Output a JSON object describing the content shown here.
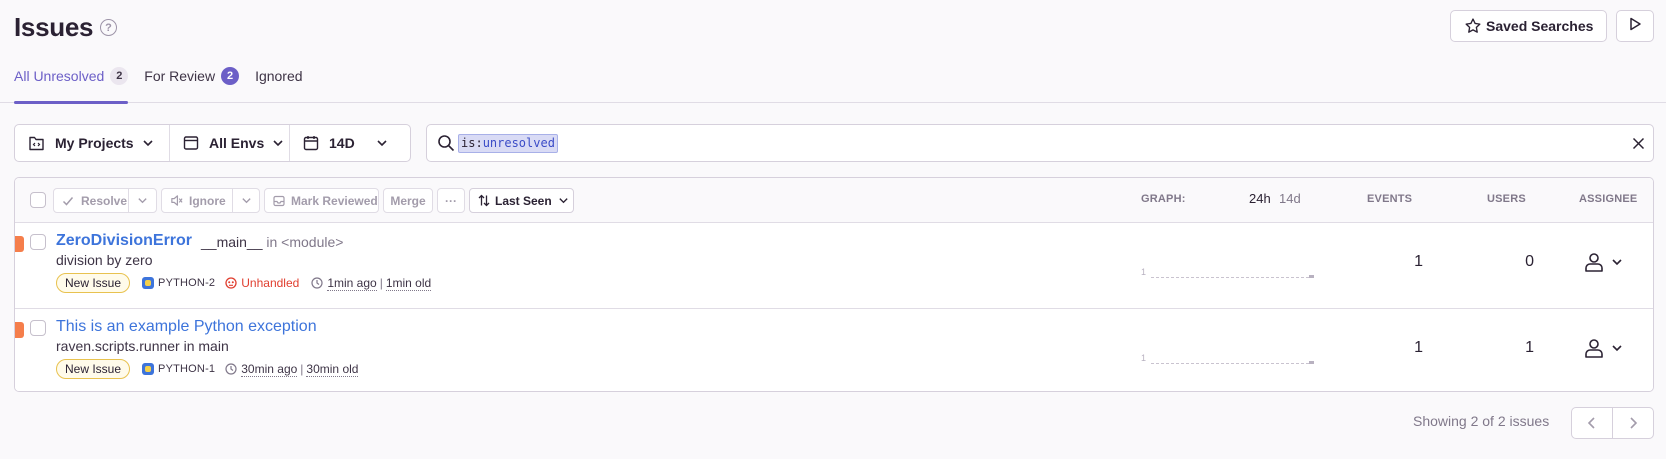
{
  "header": {
    "title": "Issues",
    "help_glyph": "?",
    "saved_searches_label": "Saved Searches"
  },
  "tabs": [
    {
      "label": "All Unresolved",
      "count": "2"
    },
    {
      "label": "For Review",
      "count": "2"
    },
    {
      "label": "Ignored"
    }
  ],
  "filters": {
    "projects": "My Projects",
    "environments": "All Envs",
    "date": "14D"
  },
  "search": {
    "key": "is:",
    "value": "unresolved"
  },
  "toolbar": {
    "resolve": "Resolve",
    "ignore": "Ignore",
    "mark_reviewed": "Mark Reviewed",
    "merge": "Merge",
    "more": "···",
    "sort": "Last Seen"
  },
  "columns": {
    "graph": "GRAPH:",
    "period_24h": "24h",
    "period_14d": "14d",
    "events": "EVENTS",
    "users": "USERS",
    "assignee": "ASSIGNEE"
  },
  "issues": [
    {
      "title": "ZeroDivisionError",
      "location_fn": "__main__",
      "location_rest": " in <module>",
      "message": "division by zero",
      "tag": "New Issue",
      "project": "PYTHON-2",
      "unhandled": "Unhandled",
      "last_seen": "1min ago",
      "first_seen": "1min old",
      "spark_label": "1",
      "events": "1",
      "users": "0"
    },
    {
      "title": "This is an example Python exception",
      "message": "raven.scripts.runner in main",
      "tag": "New Issue",
      "project": "PYTHON-1",
      "last_seen": "30min ago",
      "first_seen": "30min old",
      "spark_label": "1",
      "events": "1",
      "users": "1"
    }
  ],
  "footer": {
    "showing": "Showing 2 of 2 issues"
  },
  "colors": {
    "accent": "#6c5fc7",
    "link": "#3d74db",
    "level_error": "#f57e4b",
    "unhandled": "#e03e2f"
  },
  "icons": [
    "help-icon",
    "star-icon",
    "play-icon",
    "projects-icon",
    "environment-icon",
    "calendar-icon",
    "chevron-down-icon",
    "search-icon",
    "close-icon",
    "check-icon",
    "mute-icon",
    "inbox-icon",
    "sort-icon",
    "project-icon",
    "unhandled-icon",
    "clock-icon",
    "user-icon",
    "chevron-left-icon",
    "chevron-right-icon"
  ]
}
